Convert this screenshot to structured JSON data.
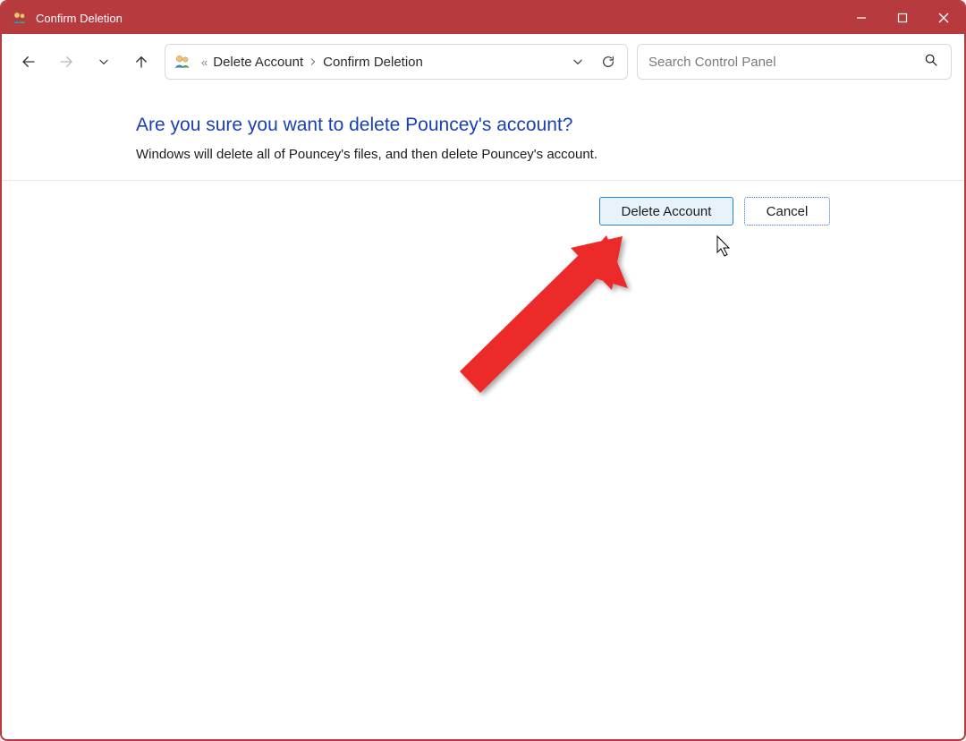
{
  "titlebar": {
    "title": "Confirm Deletion"
  },
  "breadcrumb": {
    "item1": "Delete Account",
    "item2": "Confirm Deletion"
  },
  "search": {
    "placeholder": "Search Control Panel"
  },
  "page": {
    "headline": "Are you sure you want to delete Pouncey's account?",
    "body": "Windows will delete all of Pouncey's files, and then delete Pouncey's account."
  },
  "buttons": {
    "delete": "Delete Account",
    "cancel": "Cancel"
  }
}
